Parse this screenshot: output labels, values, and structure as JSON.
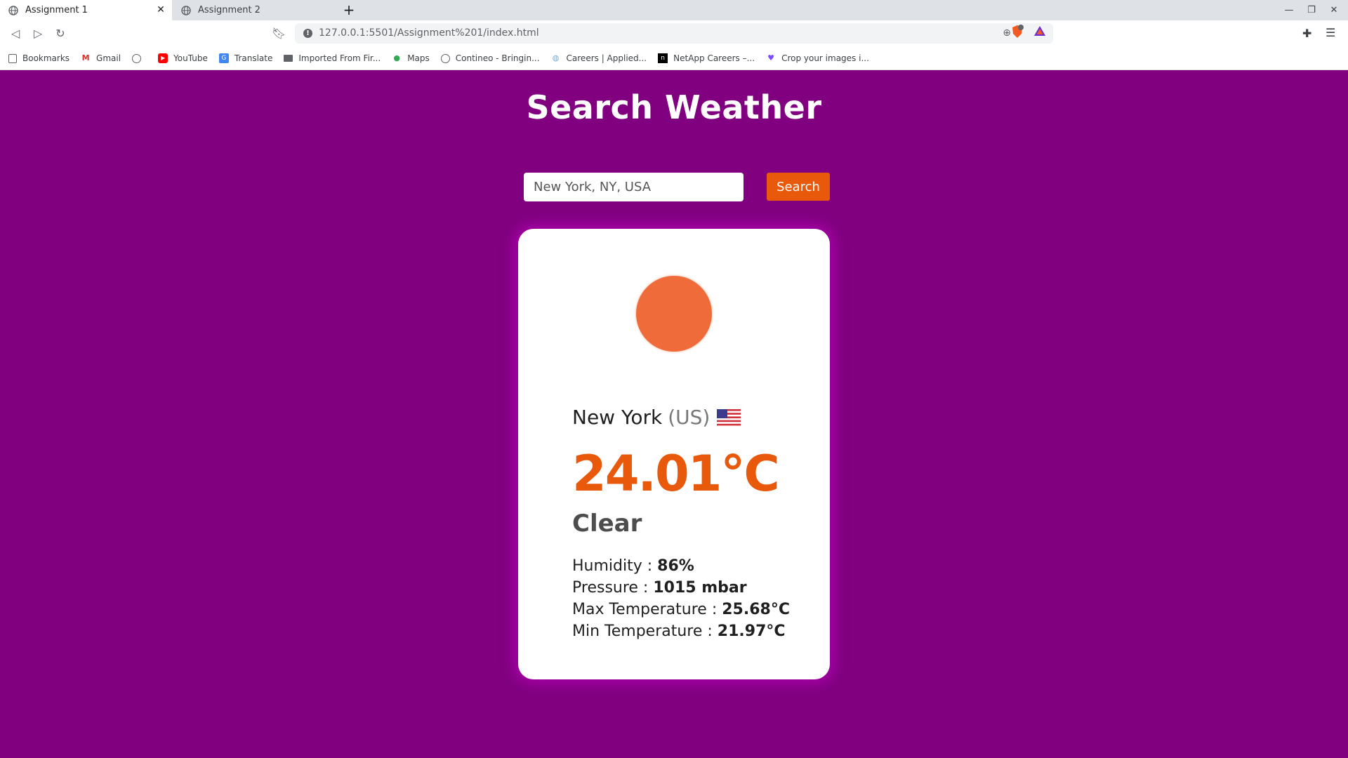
{
  "browser": {
    "tabs": [
      {
        "label": "Assignment 1",
        "active": true
      },
      {
        "label": "Assignment 2",
        "active": false
      }
    ],
    "url": "127.0.0.1:5501/Assignment%201/index.html",
    "bookmarks": [
      {
        "label": "Bookmarks",
        "icon": "bookmarks-icon"
      },
      {
        "label": "Gmail",
        "icon": "gmail-icon"
      },
      {
        "label": "",
        "icon": "globe-icon"
      },
      {
        "label": "YouTube",
        "icon": "youtube-icon"
      },
      {
        "label": "Translate",
        "icon": "translate-icon"
      },
      {
        "label": "Imported From Fir...",
        "icon": "folder-icon"
      },
      {
        "label": "Maps",
        "icon": "maps-icon"
      },
      {
        "label": "Contineo - Bringin...",
        "icon": "globe-icon"
      },
      {
        "label": "Careers | Applied...",
        "icon": "careers-icon"
      },
      {
        "label": "NetApp Careers –...",
        "icon": "netapp-icon"
      },
      {
        "label": "Crop your images i...",
        "icon": "heart-icon"
      }
    ]
  },
  "page": {
    "title": "Search Weather",
    "search": {
      "value": "New York, NY, USA",
      "button_label": "Search"
    },
    "weather": {
      "icon": "sun-icon",
      "city": "New York",
      "country": "(US)",
      "temperature": "24.01°C",
      "condition": "Clear",
      "details": [
        {
          "label": "Humidity : ",
          "value": "86%"
        },
        {
          "label": "Pressure : ",
          "value": "1015 mbar"
        },
        {
          "label": "Max Temperature : ",
          "value": "25.68°C"
        },
        {
          "label": "Min Temperature : ",
          "value": "21.97°C"
        }
      ]
    }
  },
  "colors": {
    "page_background": "#800080",
    "accent": "#e8590c",
    "sun": "#f06b3a",
    "card": "#ffffff"
  }
}
